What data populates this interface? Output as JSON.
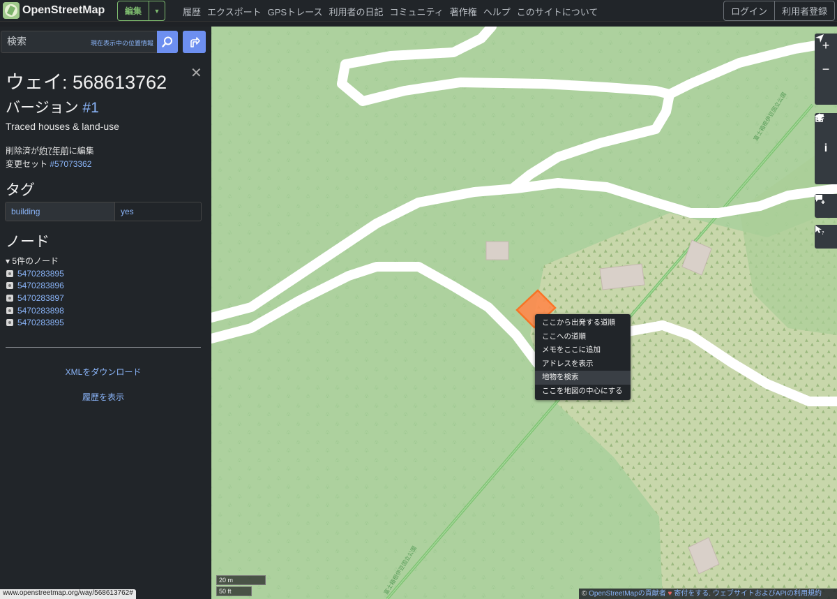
{
  "header": {
    "logo": "OpenStreetMap",
    "edit_label": "編集",
    "nav": [
      "履歴",
      "エクスポート",
      "GPSトレース",
      "利用者の日記",
      "コミュニティ",
      "著作権",
      "ヘルプ",
      "このサイトについて"
    ],
    "login": "ログイン",
    "signup": "利用者登録"
  },
  "search": {
    "placeholder": "検索",
    "where_am_i": "現在表示中の位置情報"
  },
  "feature": {
    "title": "ウェイ: 568613762",
    "version_prefix": "バージョン ",
    "version_link": "#1",
    "comment": "Traced houses & land-use",
    "deleted_prefix": "削除済が",
    "deleted_time": "約7年前",
    "deleted_suffix": "に編集",
    "changeset_prefix": "変更セット ",
    "changeset_link": "#57073362"
  },
  "tags_heading": "タグ",
  "tags": [
    {
      "key": "building",
      "value": "yes"
    }
  ],
  "nodes_heading": "ノード",
  "nodes_summary": "▾ 5件のノード",
  "nodes": [
    "5470283895",
    "5470283896",
    "5470283897",
    "5470283898",
    "5470283895"
  ],
  "links": {
    "download_xml": "XMLをダウンロード",
    "view_history": "履歴を表示"
  },
  "status_url": "www.openstreetmap.org/way/568613762#",
  "context_menu": [
    "ここから出発する道順",
    "ここへの道順",
    "メモをここに追加",
    "アドレスを表示",
    "地物を検索",
    "ここを地図の中心にする"
  ],
  "map": {
    "scale_m": "20 m",
    "scale_ft": "50 ft",
    "road_label": "富士箱根伊豆国立公園",
    "attribution": {
      "copy": "© ",
      "contributors": "OpenStreetMapの貢献者",
      "heart": " ♥ ",
      "donate": "寄付をする",
      "sep": ". ",
      "terms": "ウェブサイトおよびAPIの利用規約"
    }
  },
  "colors": {
    "forest": "#add19e",
    "scrub": "#c8d7ab",
    "road": "#ffffff",
    "building": "#d9d0c9",
    "highlight": "#ff7f3f",
    "link": "#8ab4f8"
  }
}
